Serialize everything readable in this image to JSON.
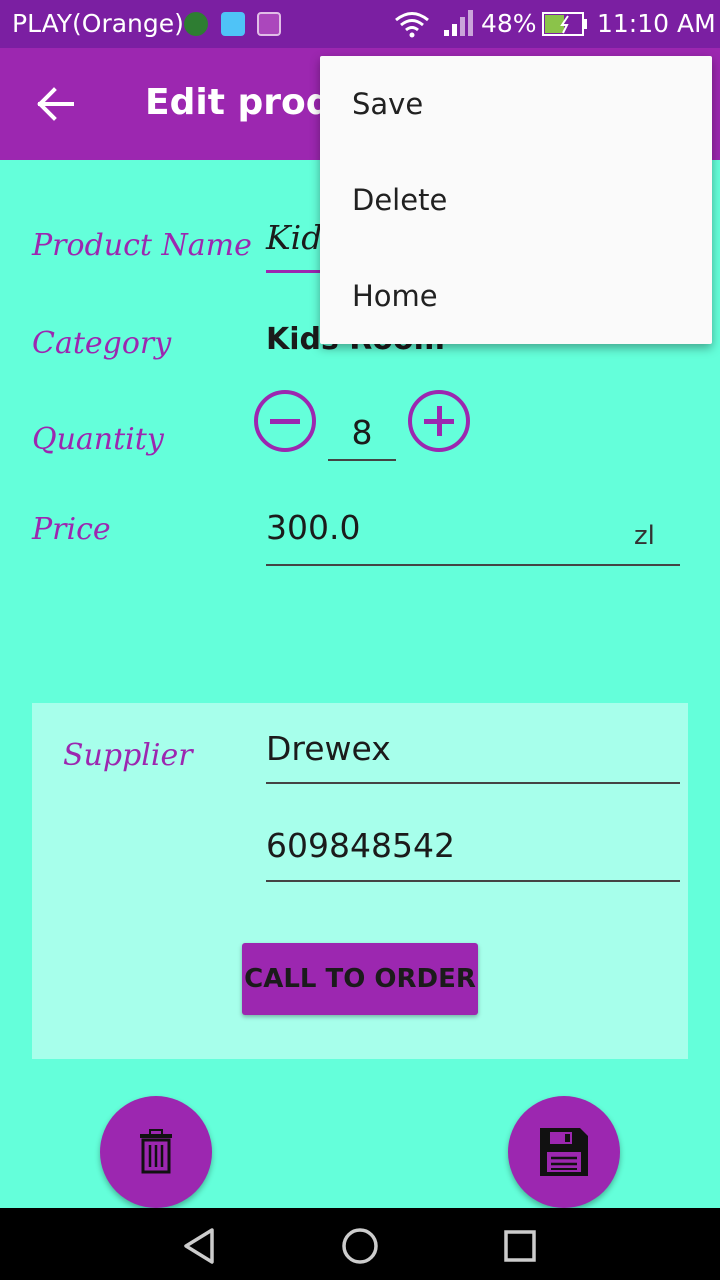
{
  "status_bar": {
    "carrier": "PLAY(Orange)",
    "battery": "48%",
    "time": "11:10 AM",
    "icons": [
      "globe-icon",
      "android-icon",
      "image-icon",
      "wifi-icon",
      "signal-icon",
      "battery-icon"
    ]
  },
  "app_bar": {
    "title": "Edit product",
    "back_icon": "arrow-back-icon"
  },
  "menu": {
    "items": [
      "Save",
      "Delete",
      "Home"
    ]
  },
  "form": {
    "product_name": {
      "label": "Product Name",
      "value": "Kids"
    },
    "category": {
      "label": "Category",
      "value": "Kids Room"
    },
    "quantity": {
      "label": "Quantity",
      "value": "8"
    },
    "price": {
      "label": "Price",
      "value": "300.0",
      "currency": "zl"
    }
  },
  "supplier": {
    "label": "Supplier",
    "name": "Drewex",
    "phone": "609848542",
    "call_label": "CALL TO ORDER"
  },
  "fabs": {
    "delete_icon": "trash-icon",
    "save_icon": "floppy-disk-icon"
  },
  "colors": {
    "primary": "#9C27B0",
    "primary_dark": "#7B1FA2",
    "background": "#64FFDA",
    "card": "#A7FFEB"
  }
}
